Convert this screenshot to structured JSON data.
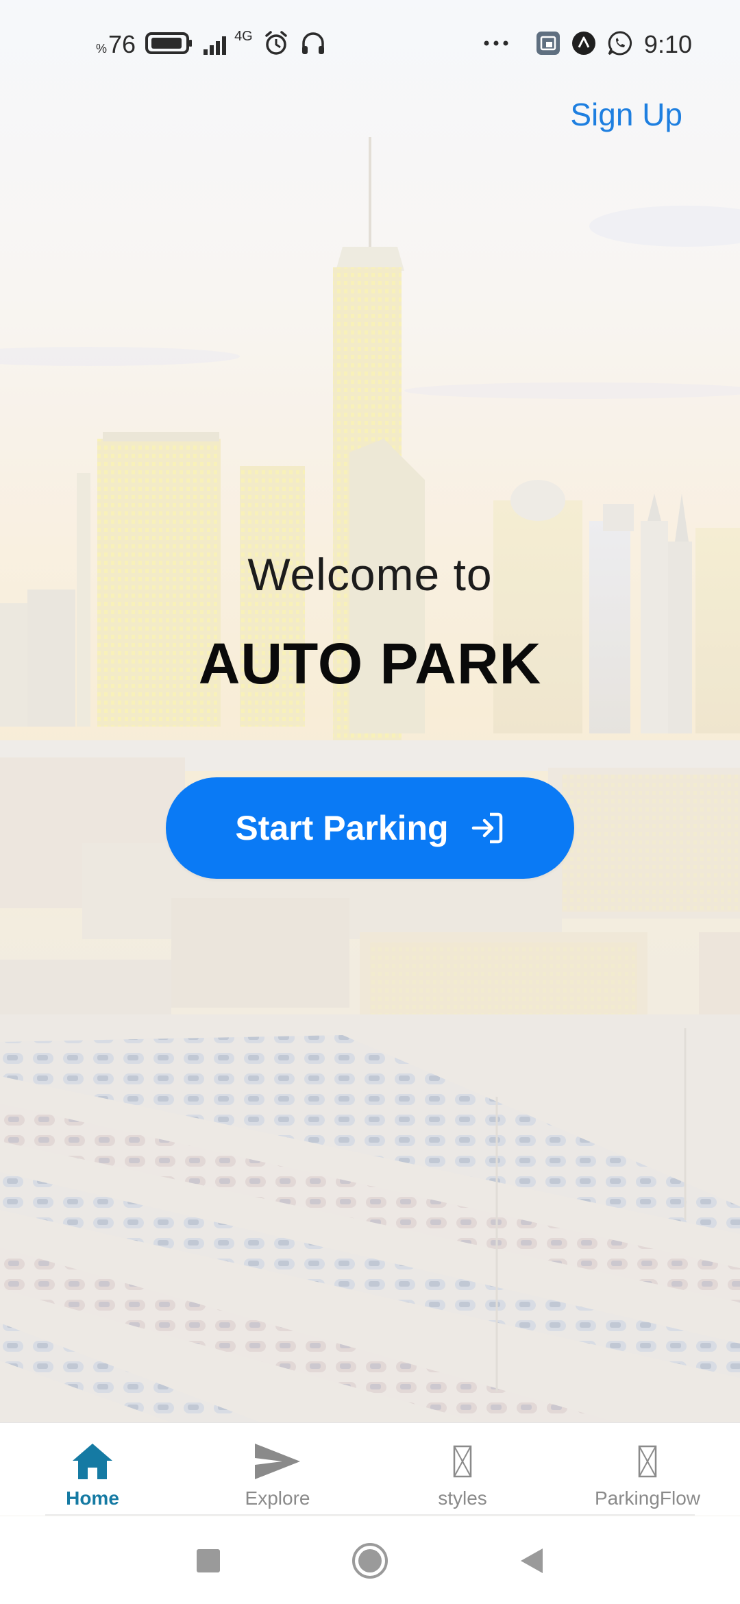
{
  "status_bar": {
    "battery_prefix": "%",
    "battery_level": "76",
    "network": "4G",
    "time": "9:10"
  },
  "header": {
    "signup_label": "Sign Up"
  },
  "hero": {
    "welcome_text": "Welcome to",
    "app_name": "AUTO PARK"
  },
  "actions": {
    "start_label": "Start Parking"
  },
  "tabs": [
    {
      "label": "Home",
      "icon": "home-icon",
      "active": true
    },
    {
      "label": "Explore",
      "icon": "send-icon",
      "active": false
    },
    {
      "label": "styles",
      "icon": "missing-glyph-icon",
      "active": false
    },
    {
      "label": "ParkingFlow",
      "icon": "missing-glyph-icon",
      "active": false
    }
  ],
  "colors": {
    "accent": "#0a7af5",
    "link": "#1e7fe0",
    "tab_active": "#157aa3",
    "tab_inactive": "#8a8a8a"
  }
}
